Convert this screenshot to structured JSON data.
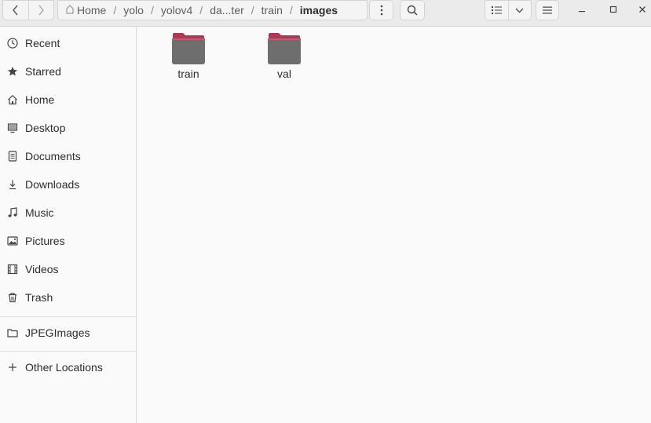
{
  "window": {
    "breadcrumb": [
      {
        "label": "Home"
      },
      {
        "label": "yolo"
      },
      {
        "label": "yolov4"
      },
      {
        "label": "da...ter"
      },
      {
        "label": "train"
      },
      {
        "label": "images"
      }
    ],
    "separator": "/"
  },
  "sidebar": {
    "items": [
      {
        "label": "Recent",
        "icon": "clock-icon"
      },
      {
        "label": "Starred",
        "icon": "star-icon"
      },
      {
        "label": "Home",
        "icon": "home-icon"
      },
      {
        "label": "Desktop",
        "icon": "desktop-icon"
      },
      {
        "label": "Documents",
        "icon": "document-icon"
      },
      {
        "label": "Downloads",
        "icon": "download-icon"
      },
      {
        "label": "Music",
        "icon": "music-icon"
      },
      {
        "label": "Pictures",
        "icon": "picture-icon"
      },
      {
        "label": "Videos",
        "icon": "video-icon"
      },
      {
        "label": "Trash",
        "icon": "trash-icon"
      }
    ],
    "bookmarks": [
      {
        "label": "JPEGImages",
        "icon": "folder-icon"
      }
    ],
    "other": {
      "label": "Other Locations",
      "icon": "plus-icon"
    }
  },
  "files": [
    {
      "name": "train"
    },
    {
      "name": "val"
    }
  ],
  "colors": {
    "folder_tab": "#a83a55",
    "folder_body": "#6b6b6b",
    "header_bg": "#ebebeb"
  }
}
